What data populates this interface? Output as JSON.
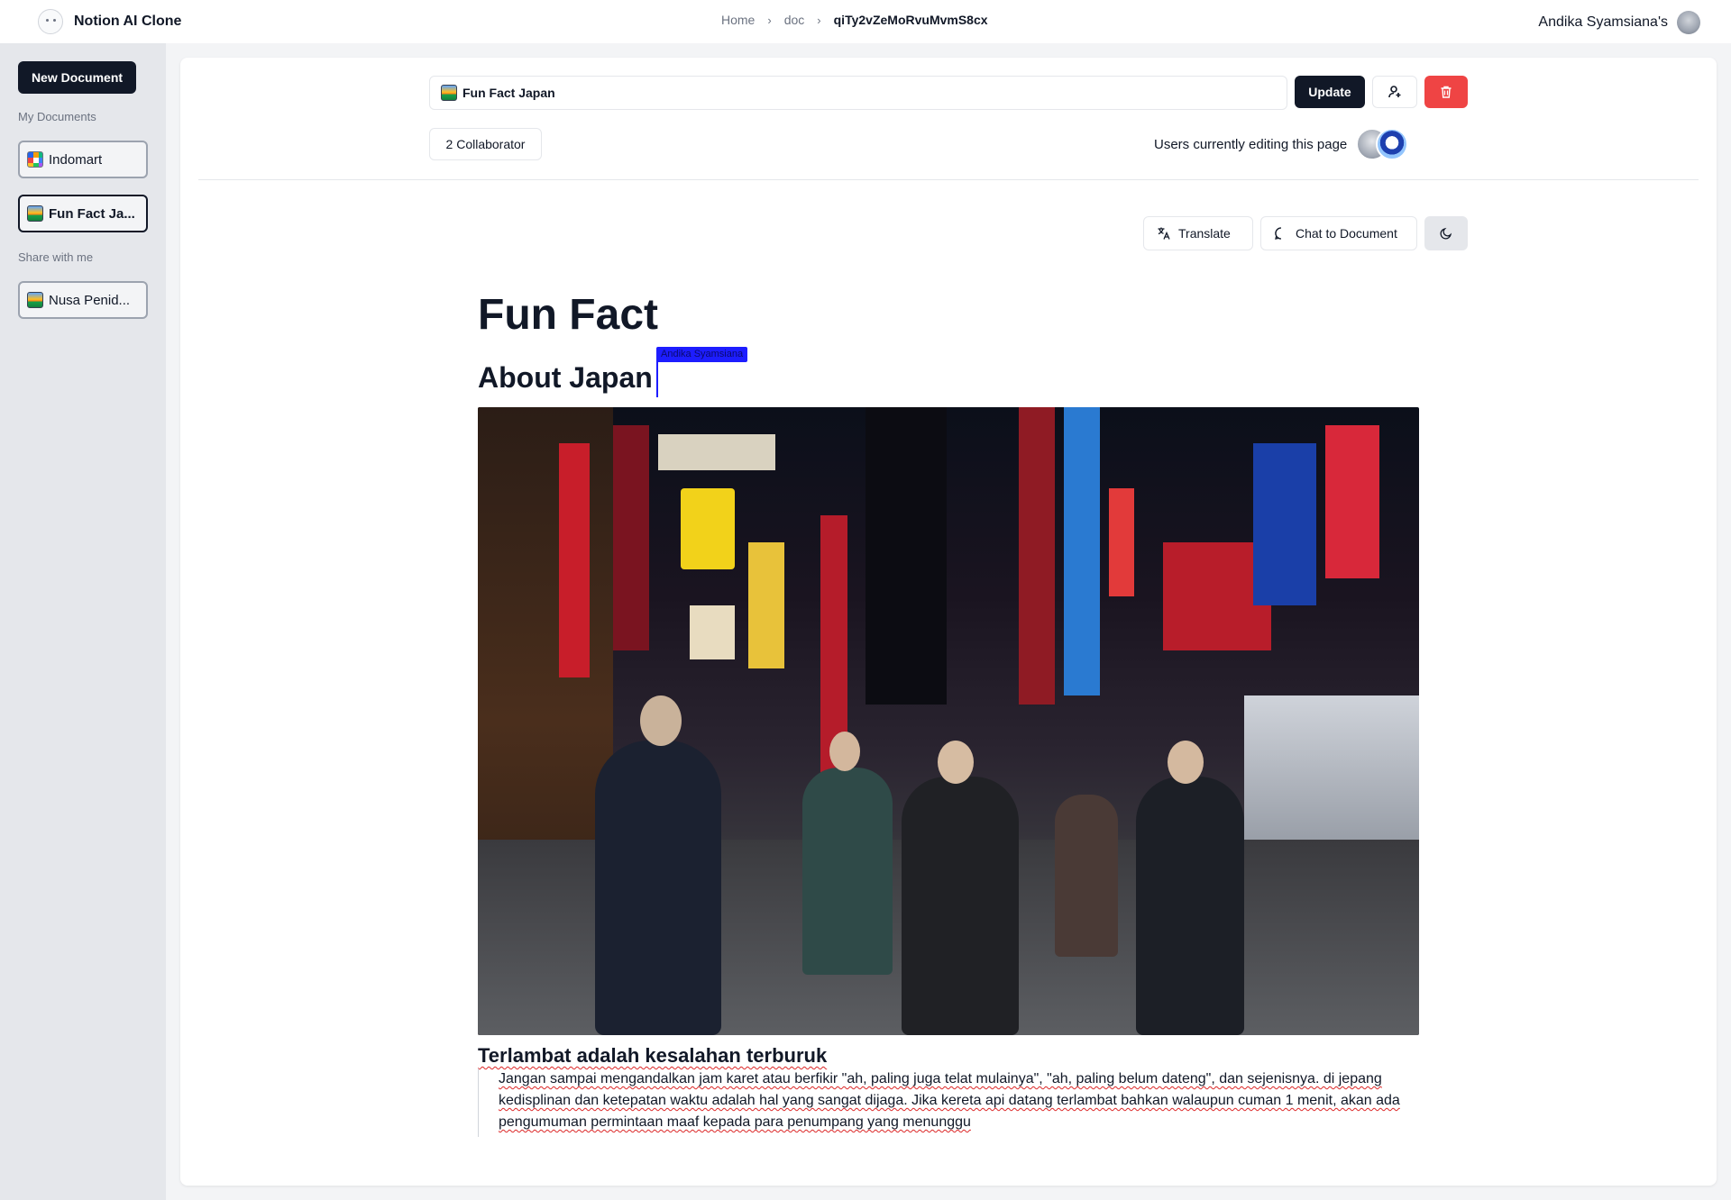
{
  "app": {
    "name": "Notion AI Clone",
    "logo_icon": "smile-logo-icon"
  },
  "breadcrumb": {
    "items": [
      "Home",
      "doc"
    ],
    "current": "qiTy2vZeMoRvuMvmS8cx"
  },
  "user": {
    "name": "Andika Syamsiana's"
  },
  "sidebar": {
    "new_document_label": "New Document",
    "my_documents_label": "My Documents",
    "shared_label": "Share with me",
    "my_documents": [
      {
        "label": "Indomart",
        "icon": "grid-emoji-icon",
        "active": false
      },
      {
        "label": "Fun Fact Ja...",
        "icon": "picture-emoji-icon",
        "active": true
      }
    ],
    "shared_documents": [
      {
        "label": "Nusa Penid...",
        "icon": "picture-emoji-icon",
        "active": false
      }
    ]
  },
  "header": {
    "title_value": "Fun Fact Japan",
    "update_label": "Update",
    "collaborator_label": "2 Collaborator",
    "editing_label": "Users currently editing this page"
  },
  "toolbar": {
    "translate_label": "Translate",
    "chat_label": "Chat to Document"
  },
  "document": {
    "heading1": "Fun Fact",
    "heading2": "About Japan",
    "cursor_user": "Andika Syamsiana",
    "heading3": "Terlambat adalah kesalahan terburuk",
    "quote": "Jangan sampai mengandalkan jam karet atau berfikir \"ah, paling juga telat mulainya\", \"ah, paling belum dateng\", dan sejenisnya. di jepang kedisplinan dan ketepatan waktu adalah hal yang sangat dijaga. Jika kereta api datang terlambat bahkan walaupun cuman 1 menit, akan ada pengumuman permintaan maaf kepada para penumpang yang menunggu"
  },
  "colors": {
    "primary": "#111827",
    "danger": "#ef4444",
    "cursor": "#1d1dff",
    "spellcheck": "#dc2626"
  }
}
